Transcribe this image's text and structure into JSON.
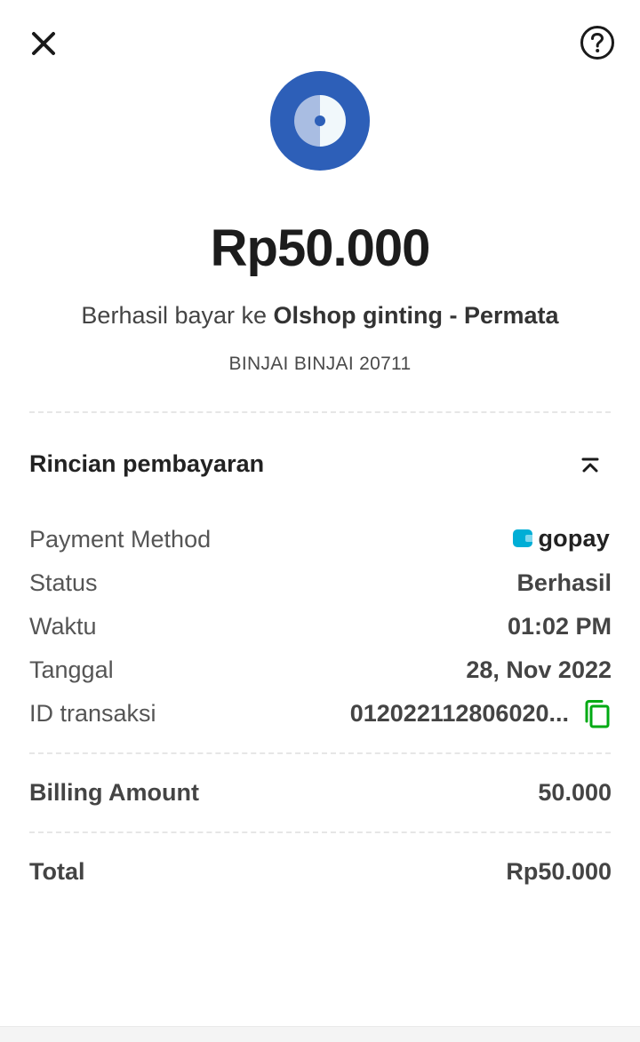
{
  "header": {
    "close_icon": "close-icon",
    "help_icon": "question-circle-icon"
  },
  "merchant_logo": {
    "icon": "merchant-disc-logo",
    "colors": {
      "outer": "#2d5fb8",
      "left_half": "#a9bde2",
      "right_half": "#f1f8fb",
      "dot": "#2d5fb8"
    }
  },
  "summary": {
    "amount": "Rp50.000",
    "prefix": "Berhasil bayar ke ",
    "merchant_name": "Olshop ginting - Permata",
    "address": "BINJAI BINJAI 20711"
  },
  "details": {
    "title": "Rincian pembayaran",
    "collapse_icon": "chevron-up-double-icon",
    "payment_method": {
      "label": "Payment Method",
      "value": "gopay",
      "brand_color": "#00aed6"
    },
    "status": {
      "label": "Status",
      "value": "Berhasil"
    },
    "time": {
      "label": "Waktu",
      "value": "01:02 PM"
    },
    "date": {
      "label": "Tanggal",
      "value": "28, Nov 2022"
    },
    "transaction_id": {
      "label": "ID transaksi",
      "value": "012022112806020...",
      "copy_icon": "copy-icon",
      "copy_color": "#00aa13"
    }
  },
  "billing": {
    "label": "Billing Amount",
    "value": "50.000"
  },
  "total": {
    "label": "Total",
    "value": "Rp50.000"
  }
}
